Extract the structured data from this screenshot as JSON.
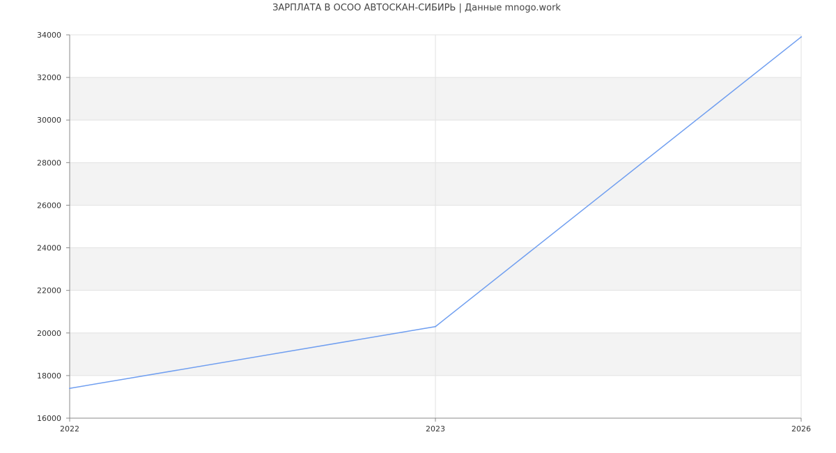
{
  "chart_data": {
    "type": "line",
    "title": "ЗАРПЛАТА В ОСОО АВТОСКАН-СИБИРЬ | Данные mnogo.work",
    "xlabel": "",
    "ylabel": "",
    "x": [
      "2022",
      "2023",
      "2026"
    ],
    "series": [
      {
        "values": [
          17400,
          20300,
          33900
        ]
      }
    ],
    "ylim": [
      16000,
      34000
    ],
    "y_ticks": [
      16000,
      18000,
      20000,
      22000,
      24000,
      26000,
      28000,
      30000,
      32000,
      34000
    ],
    "x_ticks": [
      "2022",
      "2023",
      "2026"
    ],
    "grid": true,
    "legend": "none"
  },
  "colors": {
    "line": "#6f9ef0",
    "band": "#f3f3f3",
    "grid": "#e2e2e2",
    "axis": "#888888"
  }
}
